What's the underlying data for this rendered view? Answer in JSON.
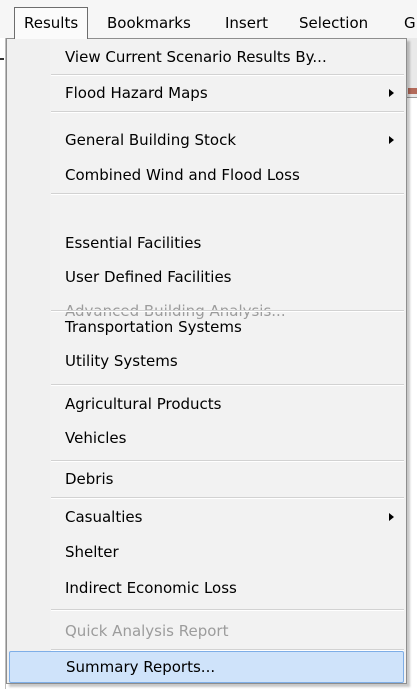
{
  "menubar": {
    "items": [
      {
        "label": "Results",
        "active": true
      },
      {
        "label": "Bookmarks"
      },
      {
        "label": "Insert"
      },
      {
        "label": "Selection"
      },
      {
        "label": "G"
      }
    ]
  },
  "menu": {
    "items": [
      {
        "label": "View Current Scenario Results By..."
      },
      {
        "label": "Flood Hazard Maps",
        "submenu": true
      },
      {
        "label": "General Building Stock",
        "submenu": true
      },
      {
        "label": "Combined Wind and Flood Loss"
      },
      {
        "label": "Essential Facilities"
      },
      {
        "label": "User Defined Facilities"
      },
      {
        "label": "Advanced Building Analysis...",
        "disabled": true
      },
      {
        "label": "Transportation Systems"
      },
      {
        "label": "Utility Systems"
      },
      {
        "label": "Agricultural Products"
      },
      {
        "label": "Vehicles"
      },
      {
        "label": "Debris"
      },
      {
        "label": "Casualties",
        "submenu": true
      },
      {
        "label": "Shelter"
      },
      {
        "label": "Indirect Economic Loss"
      },
      {
        "label": "Quick Analysis Report",
        "disabled": true
      },
      {
        "label": "Summary Reports...",
        "selected": true
      }
    ]
  },
  "colors": {
    "highlight": "#cfe3fa",
    "highlight_border": "#7eaee7",
    "disabled_text": "#9c9c9c"
  }
}
